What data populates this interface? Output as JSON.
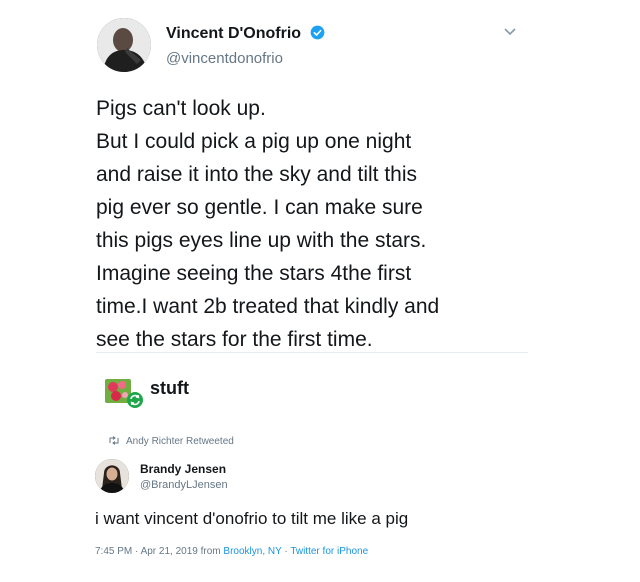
{
  "tweet_main": {
    "display_name": "Vincent D'Onofrio",
    "handle": "@vincentdonofrio",
    "verified": true,
    "menu_icon": "chevron-down-icon",
    "lines": [
      "Pigs can't look up.",
      "But I could pick a pig up one night",
      "and raise it into the sky and tilt this",
      "pig ever so gentle. I can make sure",
      "this pigs eyes line up with the stars.",
      "Imagine seeing the stars 4the first",
      "time.I want 2b treated that kindly and",
      "see the stars for the first time."
    ]
  },
  "watermark": {
    "label": "stuft"
  },
  "tweet_retweeted": {
    "retweet_context": "Andy Richter Retweeted",
    "display_name": "Brandy Jensen",
    "handle": "@BrandyLJensen",
    "text": "i want vincent d'onofrio to tilt me like a pig",
    "timestamp": "7:45 PM · Apr 21, 2019 from",
    "location": "Brooklyn, NY",
    "separator": " · ",
    "source": "Twitter for iPhone"
  },
  "colors": {
    "text_primary": "#14171a",
    "text_secondary": "#657786",
    "link_blue": "#1b95e0",
    "verified_blue": "#1da1f2"
  }
}
